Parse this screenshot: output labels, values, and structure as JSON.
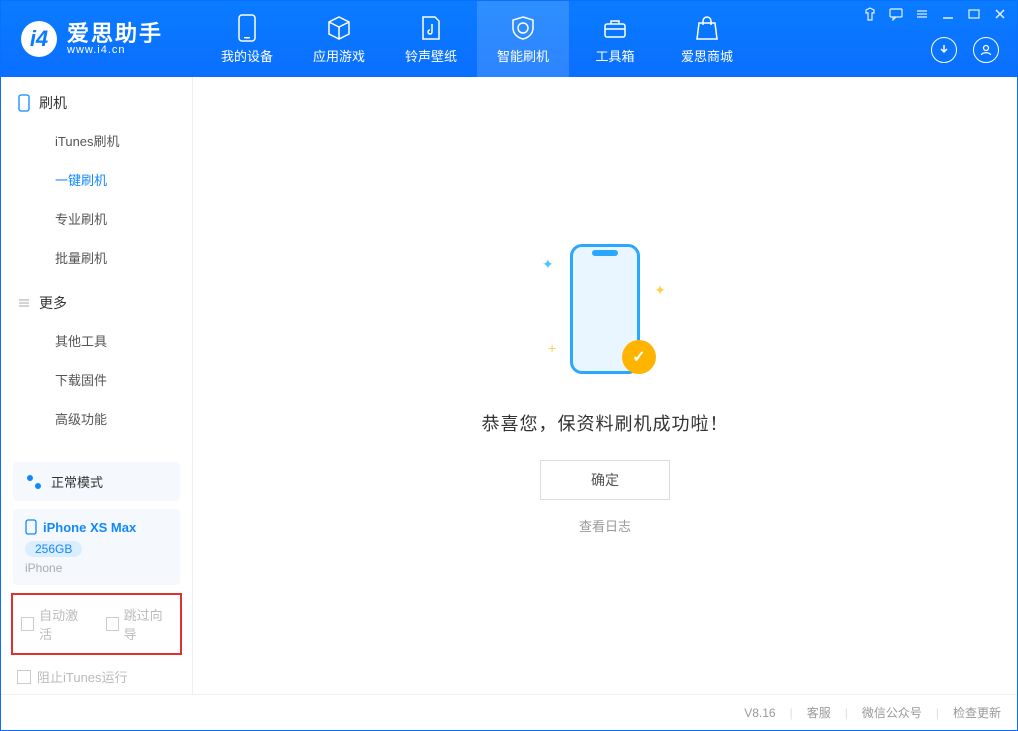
{
  "app": {
    "name_cn": "爱思助手",
    "name_en": "www.i4.cn"
  },
  "nav": {
    "items": [
      {
        "label": "我的设备"
      },
      {
        "label": "应用游戏"
      },
      {
        "label": "铃声壁纸"
      },
      {
        "label": "智能刷机"
      },
      {
        "label": "工具箱"
      },
      {
        "label": "爱思商城"
      }
    ],
    "active_index": 3
  },
  "sidebar": {
    "sections": [
      {
        "title": "刷机",
        "items": [
          "iTunes刷机",
          "一键刷机",
          "专业刷机",
          "批量刷机"
        ],
        "active_index": 1
      },
      {
        "title": "更多",
        "items": [
          "其他工具",
          "下载固件",
          "高级功能"
        ]
      }
    ],
    "status_mode": "正常模式",
    "device": {
      "name": "iPhone XS Max",
      "capacity": "256GB",
      "type": "iPhone"
    },
    "options": {
      "auto_activate": "自动激活",
      "skip_guide": "跳过向导"
    },
    "block_itunes": "阻止iTunes运行"
  },
  "content": {
    "success_message": "恭喜您，保资料刷机成功啦！",
    "ok_button": "确定",
    "view_log": "查看日志"
  },
  "statusbar": {
    "version": "V8.16",
    "links": [
      "客服",
      "微信公众号",
      "检查更新"
    ]
  }
}
